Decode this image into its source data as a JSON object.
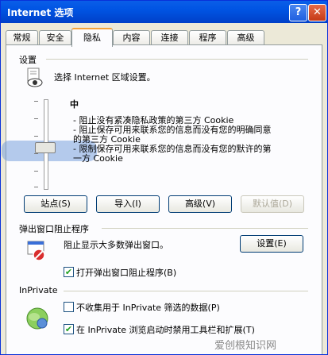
{
  "window": {
    "title": "Internet 选项",
    "help_glyph": "?",
    "close_glyph": "✕"
  },
  "tabs": [
    "常规",
    "安全",
    "隐私",
    "内容",
    "连接",
    "程序",
    "高级"
  ],
  "active_tab": "隐私",
  "settings": {
    "group_label": "设置",
    "instruction": "选择 Internet 区域设置。",
    "level": "中",
    "desc": [
      "- 阻止没有紧凑隐私政策的第三方 Cookie",
      "- 阻止保存可用来联系您的信息而没有您的明确同意",
      "的第三方 Cookie",
      "- 限制保存可用来联系您的信息而没有您的默许的第",
      "一方 Cookie"
    ],
    "buttons": {
      "sites": "站点(S)",
      "import": "导入(I)",
      "advanced": "高级(V)",
      "default": "默认值(D)"
    }
  },
  "popup": {
    "group_label": "弹出窗口阻止程序",
    "desc": "阻止显示大多数弹出窗口。",
    "settings_button": "设置(E)",
    "checkbox_label": "打开弹出窗口阻止程序(B)",
    "checked": true
  },
  "inprivate": {
    "group_label": "InPrivate",
    "checkbox1_label": "不收集用于 InPrivate 筛选的数据(P)",
    "checkbox1_checked": false,
    "checkbox2_label": "在 InPrivate 浏览启动时禁用工具栏和扩展(T)",
    "checkbox2_checked": true
  },
  "watermark": "爱创根知识网"
}
